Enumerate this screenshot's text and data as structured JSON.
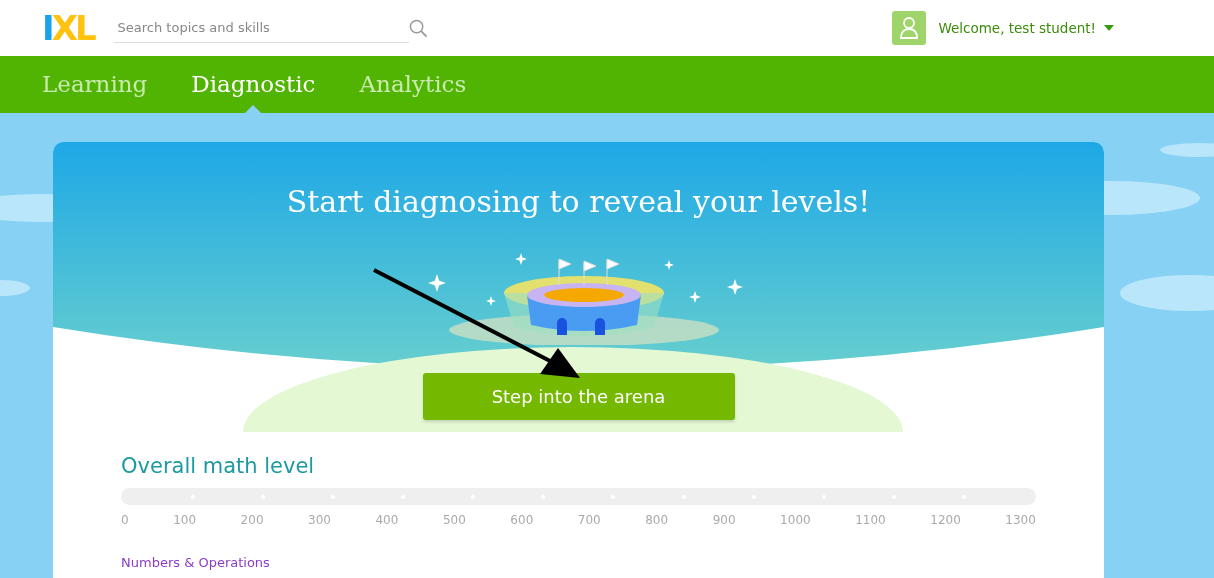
{
  "header": {
    "logo": "IXL",
    "search": {
      "placeholder": "Search topics and skills"
    },
    "user": {
      "greeting": "Welcome, test student!"
    }
  },
  "tabs": [
    {
      "label": "Learning",
      "selected": false
    },
    {
      "label": "Diagnostic",
      "selected": true
    },
    {
      "label": "Analytics",
      "selected": false
    }
  ],
  "hero": {
    "title": "Start diagnosing to reveal your levels!",
    "button": "Step into the arena"
  },
  "overall": {
    "title": "Overall math level",
    "scale": [
      "0",
      "100",
      "200",
      "300",
      "400",
      "500",
      "600",
      "700",
      "800",
      "900",
      "1000",
      "1100",
      "1200",
      "1300"
    ]
  },
  "next_section": {
    "title": "Numbers & Operations"
  }
}
